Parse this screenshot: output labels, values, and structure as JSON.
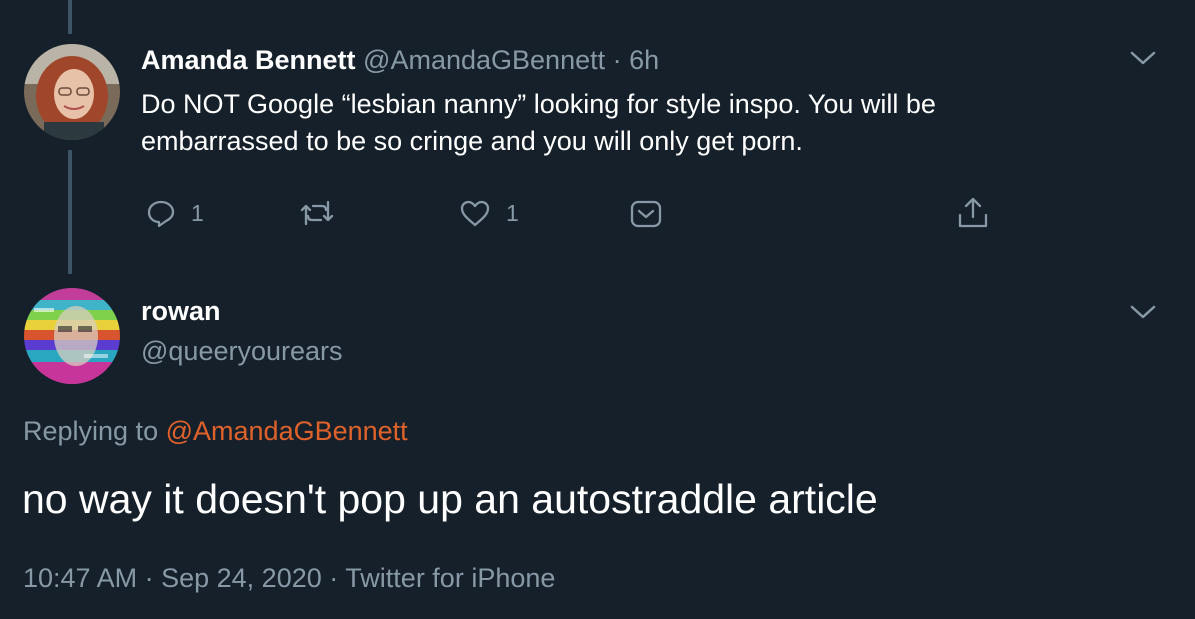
{
  "parent_tweet": {
    "author_name": "Amanda Bennett",
    "author_handle": "@AmandaGBennett",
    "separator": "·",
    "age": "6h",
    "text": "Do NOT Google “lesbian nanny” looking for style inspo. You will be embarrassed to be so cringe and you will only get porn.",
    "actions": {
      "reply_icon": "reply-icon",
      "reply_count": "1",
      "retweet_icon": "retweet-icon",
      "retweet_count": "",
      "like_icon": "heart-icon",
      "like_count": "1",
      "save_icon": "bookmark-icon",
      "share_icon": "share-icon"
    }
  },
  "reply_tweet": {
    "author_name": "rowan",
    "author_handle": "@queeryourears",
    "replying_prefix": "Replying to",
    "replying_to": "@AmandaGBennett",
    "text": "no way it doesn't pop up an autostraddle article",
    "time": "10:47 AM",
    "separator1": "·",
    "date": "Sep 24, 2020",
    "separator2": "·",
    "source": "Twitter for iPhone"
  },
  "colors": {
    "background": "#15202b",
    "secondary_text": "#8899a6",
    "mention": "#e0622b",
    "thread_line": "#3d5466"
  }
}
